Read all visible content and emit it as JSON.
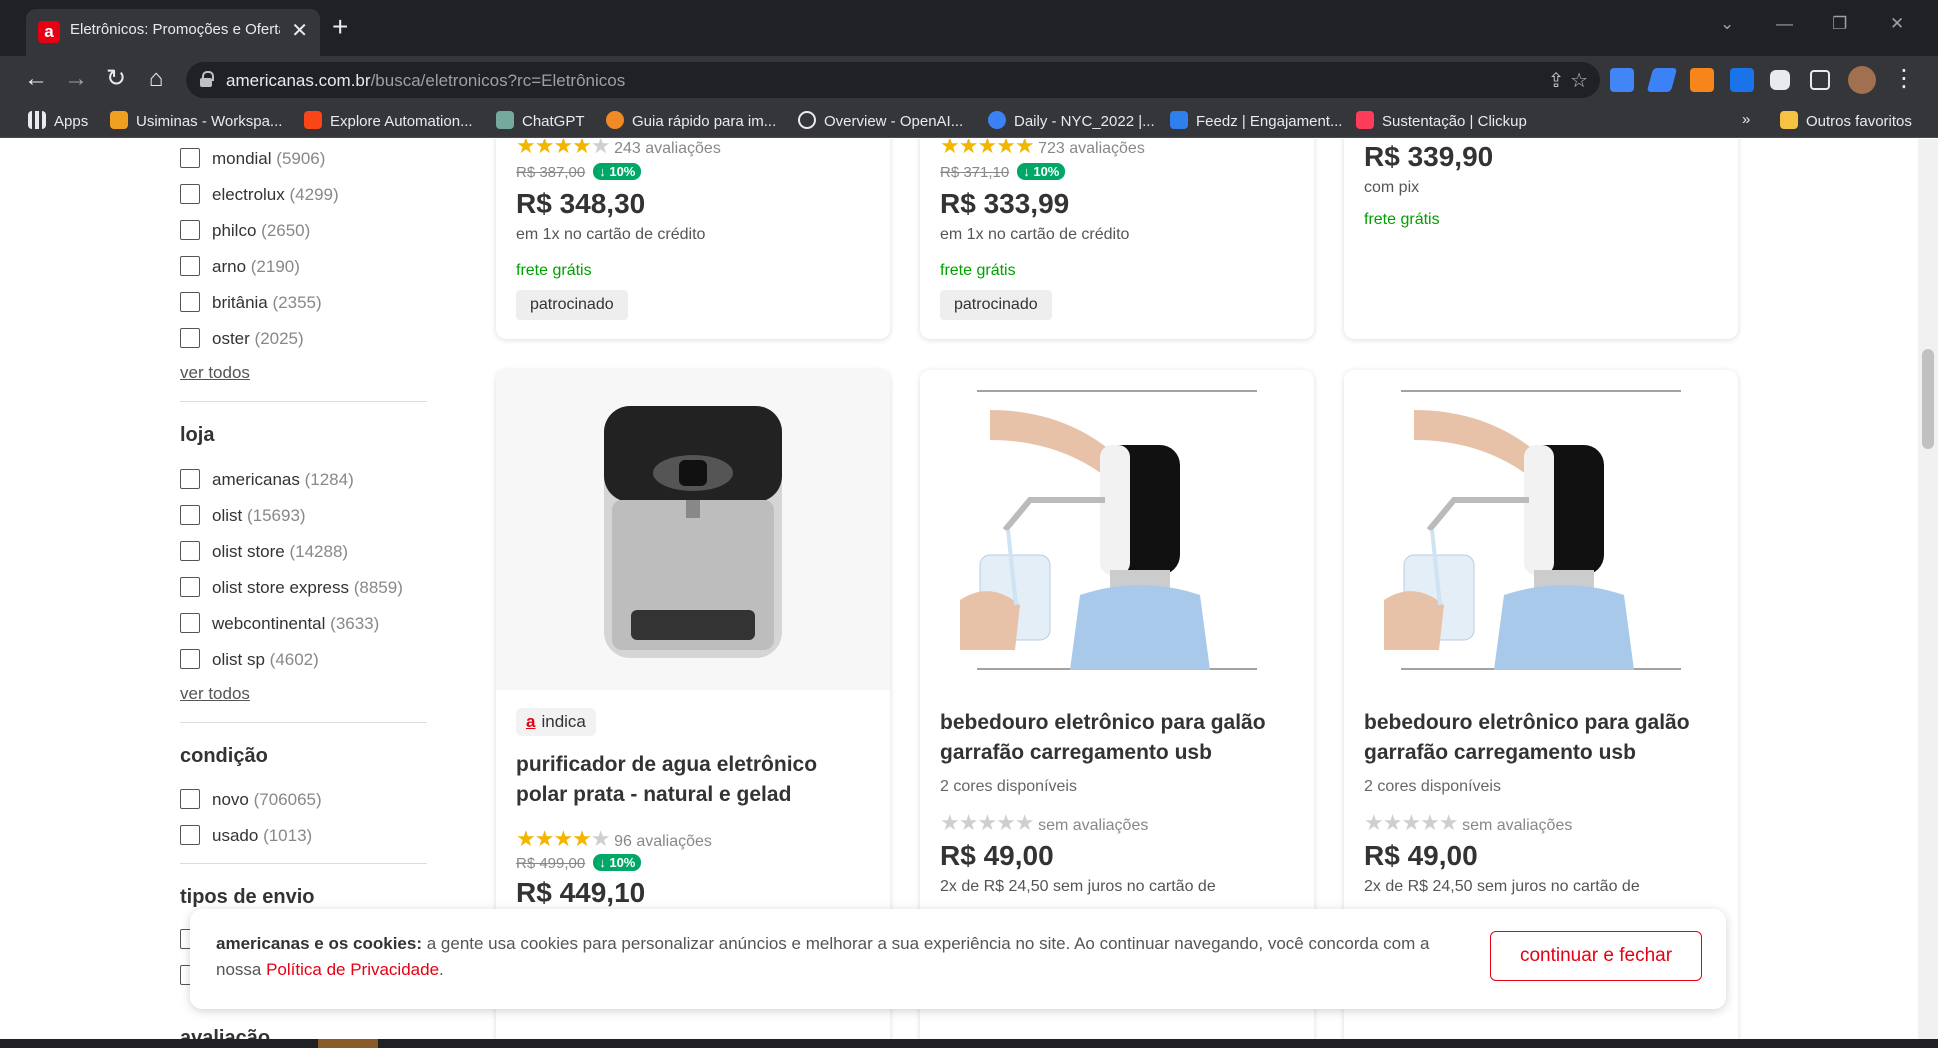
{
  "browser": {
    "tab": {
      "title": "Eletrônicos: Promoções e Ofertas",
      "favicon_letter": "a",
      "close": "✕"
    },
    "new_tab": "+",
    "window_controls": [
      "⌄",
      "—",
      "❐",
      "✕"
    ],
    "nav": {
      "back": "←",
      "forward": "→",
      "reload": "↻",
      "home": "⌂"
    },
    "url": {
      "host": "americanas.com.br",
      "path": "/busca/eletronicos?rc=Eletrônicos"
    },
    "url_actions": "⇪ ☆",
    "menu": "⋮",
    "bookmarks": [
      {
        "label": "Apps",
        "icon": "apps-grid-icon",
        "color": "#e8eaed"
      },
      {
        "label": "Usiminas - Workspa...",
        "icon": "usiminas-icon",
        "color": "#f0a020"
      },
      {
        "label": "Explore Automation...",
        "icon": "uipath-icon",
        "color": "#fa4616"
      },
      {
        "label": "ChatGPT",
        "icon": "chatgpt-icon",
        "color": "#74aa9c"
      },
      {
        "label": "Guia rápido para im...",
        "icon": "globe-icon",
        "color": "#f08a24"
      },
      {
        "label": "Overview - OpenAI...",
        "icon": "openai-icon",
        "color": "#e8eaed"
      },
      {
        "label": "Daily - NYC_2022 |...",
        "icon": "daily-icon",
        "color": "#3b82f6"
      },
      {
        "label": "Feedz | Engajament...",
        "icon": "feedz-icon",
        "color": "#2f80ed"
      },
      {
        "label": "Sustentação | Clickup",
        "icon": "clickup-icon",
        "color": "#ff3b5c"
      }
    ],
    "bookmarks_overflow": "»",
    "other_bookmarks": "Outros favoritos"
  },
  "sidebar": {
    "brand_items": [
      {
        "label": "mondial",
        "count": "(5906)"
      },
      {
        "label": "electrolux",
        "count": "(4299)"
      },
      {
        "label": "philco",
        "count": "(2650)"
      },
      {
        "label": "arno",
        "count": "(2190)"
      },
      {
        "label": "britânia",
        "count": "(2355)"
      },
      {
        "label": "oster",
        "count": "(2025)"
      }
    ],
    "ver_todos_1": "ver todos",
    "loja_title": "loja",
    "loja_items": [
      {
        "label": "americanas",
        "count": "(1284)"
      },
      {
        "label": "olist",
        "count": "(15693)"
      },
      {
        "label": "olist store",
        "count": "(14288)"
      },
      {
        "label": "olist store express",
        "count": "(8859)"
      },
      {
        "label": "webcontinental",
        "count": "(3633)"
      },
      {
        "label": "olist sp",
        "count": "(4602)"
      }
    ],
    "ver_todos_2": "ver todos",
    "condicao_title": "condição",
    "condicao_items": [
      {
        "label": "novo",
        "count": "(706065)"
      },
      {
        "label": "usado",
        "count": "(1013)"
      }
    ],
    "envio_title": "tipos de envio",
    "avaliacao_title": "avaliação"
  },
  "products_top": [
    {
      "rating_text": "243 avaliações",
      "rating": 3.5,
      "old_price": "R$ 387,00",
      "discount": "↓ 10%",
      "price": "R$ 348,30",
      "installment": "em 1x no cartão de crédito",
      "shipping": "frete grátis",
      "sponsored": "patrocinado"
    },
    {
      "rating_text": "723 avaliações",
      "rating": 4.5,
      "old_price": "R$ 371,10",
      "discount": "↓ 10%",
      "price": "R$ 333,99",
      "installment": "em 1x no cartão de crédito",
      "shipping": "frete grátis",
      "sponsored": "patrocinado"
    },
    {
      "price": "R$ 339,90",
      "installment": "com pix",
      "shipping": "frete grátis"
    }
  ],
  "products_bottom": [
    {
      "badge": "indica",
      "badge_letter": "a",
      "name_line1": "purificador de agua eletrônico",
      "name_line2": "polar prata - natural e gelad",
      "rating_text": "96 avaliações",
      "rating": 3.5,
      "old_price": "R$ 499,00",
      "discount": "↓ 10%",
      "price": "R$ 449,10",
      "image": "water-purifier-image"
    },
    {
      "name_line1": "bebedouro eletrônico para galão",
      "name_line2": "garrafão carregamento usb",
      "variants": "2 cores disponíveis",
      "rating_text": "sem avaliações",
      "rating": 0,
      "price": "R$ 49,00",
      "installment": "2x de R$ 24,50 sem juros no cartão de",
      "image": "water-pump-image"
    },
    {
      "name_line1": "bebedouro eletrônico para galão",
      "name_line2": "garrafão carregamento usb",
      "variants": "2 cores disponíveis",
      "rating_text": "sem avaliações",
      "rating": 0,
      "price": "R$ 49,00",
      "installment": "2x de R$ 24,50 sem juros no cartão de",
      "image": "water-pump-image"
    }
  ],
  "cookie_banner": {
    "bold": "americanas e os cookies:",
    "text": " a gente usa cookies para personalizar anúncios e melhorar a sua experiência no site. Ao continuar navegando, você concorda com a nossa ",
    "link": "Política de Privacidade",
    "end": ".",
    "button": "continuar e fechar"
  },
  "colors": {
    "brand_red": "#e60014",
    "free_shipping_green": "#00a000",
    "discount_green": "#00a868",
    "star_yellow": "#f3b600"
  }
}
